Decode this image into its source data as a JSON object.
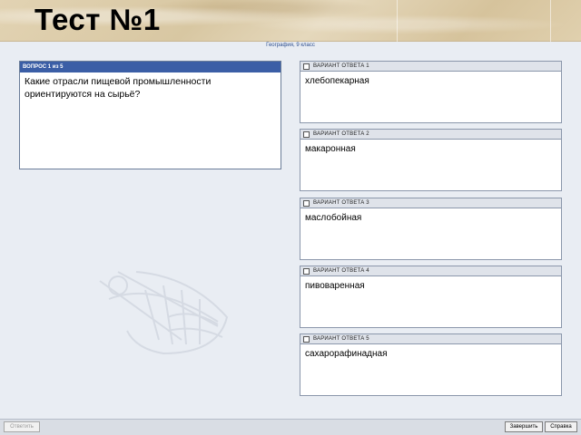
{
  "header": {
    "title": "Тест №1"
  },
  "subtitle": "География, 9 класс",
  "question": {
    "counter": "ВОПРОС 1 из 5",
    "text": "Какие отрасли пищевой промышленности ориентируются на сырьё?"
  },
  "answers": [
    {
      "label": "ВАРИАНТ ОТВЕТА 1",
      "text": "хлебопекарная",
      "checked": false
    },
    {
      "label": "ВАРИАНТ ОТВЕТА 2",
      "text": "макаронная",
      "checked": false
    },
    {
      "label": "ВАРИАНТ ОТВЕТА 3",
      "text": "маслобойная",
      "checked": false
    },
    {
      "label": "ВАРИАНТ ОТВЕТА 4",
      "text": "пивоваренная",
      "checked": false
    },
    {
      "label": "ВАРИАНТ ОТВЕТА 5",
      "text": "сахарорафинадная",
      "checked": false
    }
  ],
  "buttons": {
    "submit": "Ответить",
    "finish": "Завершить",
    "help": "Справка"
  },
  "colors": {
    "question_header": "#3b5ea6",
    "background": "#e9edf3"
  }
}
